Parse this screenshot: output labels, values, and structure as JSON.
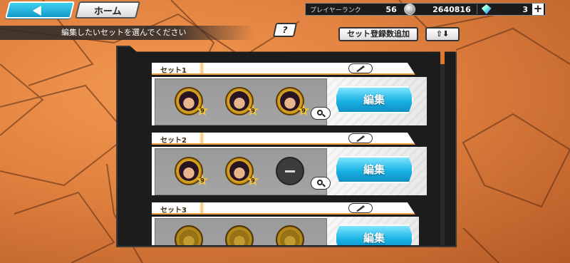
{
  "header": {
    "home_label": "ホーム",
    "player_rank_label": "プレイヤーランク",
    "player_rank_value": "56",
    "coins_value": "2640816",
    "gems_value": "3",
    "plus_symbol": "+"
  },
  "toolbar": {
    "instruction": "編集したいセットを選んでください",
    "help_label": "?",
    "add_set_label": "セット登録数追加",
    "sort_label": "⇧⬇"
  },
  "sets": [
    {
      "label": "セット1",
      "edit_label": "編集",
      "slots": [
        {
          "level": "9"
        },
        {
          "level": "9"
        },
        {
          "level": "9"
        }
      ]
    },
    {
      "label": "セット2",
      "edit_label": "編集",
      "slots": [
        {
          "level": "9"
        },
        {
          "level": "9"
        },
        {
          "empty": true
        }
      ]
    },
    {
      "label": "セット3",
      "edit_label": "編集",
      "slots": [
        {
          "level": ""
        },
        {
          "level": ""
        },
        {
          "level": ""
        }
      ]
    }
  ],
  "colors": {
    "accent_blue": "#1ab2e4",
    "gold": "#d6a21e",
    "background_orange": "#e0803f"
  }
}
